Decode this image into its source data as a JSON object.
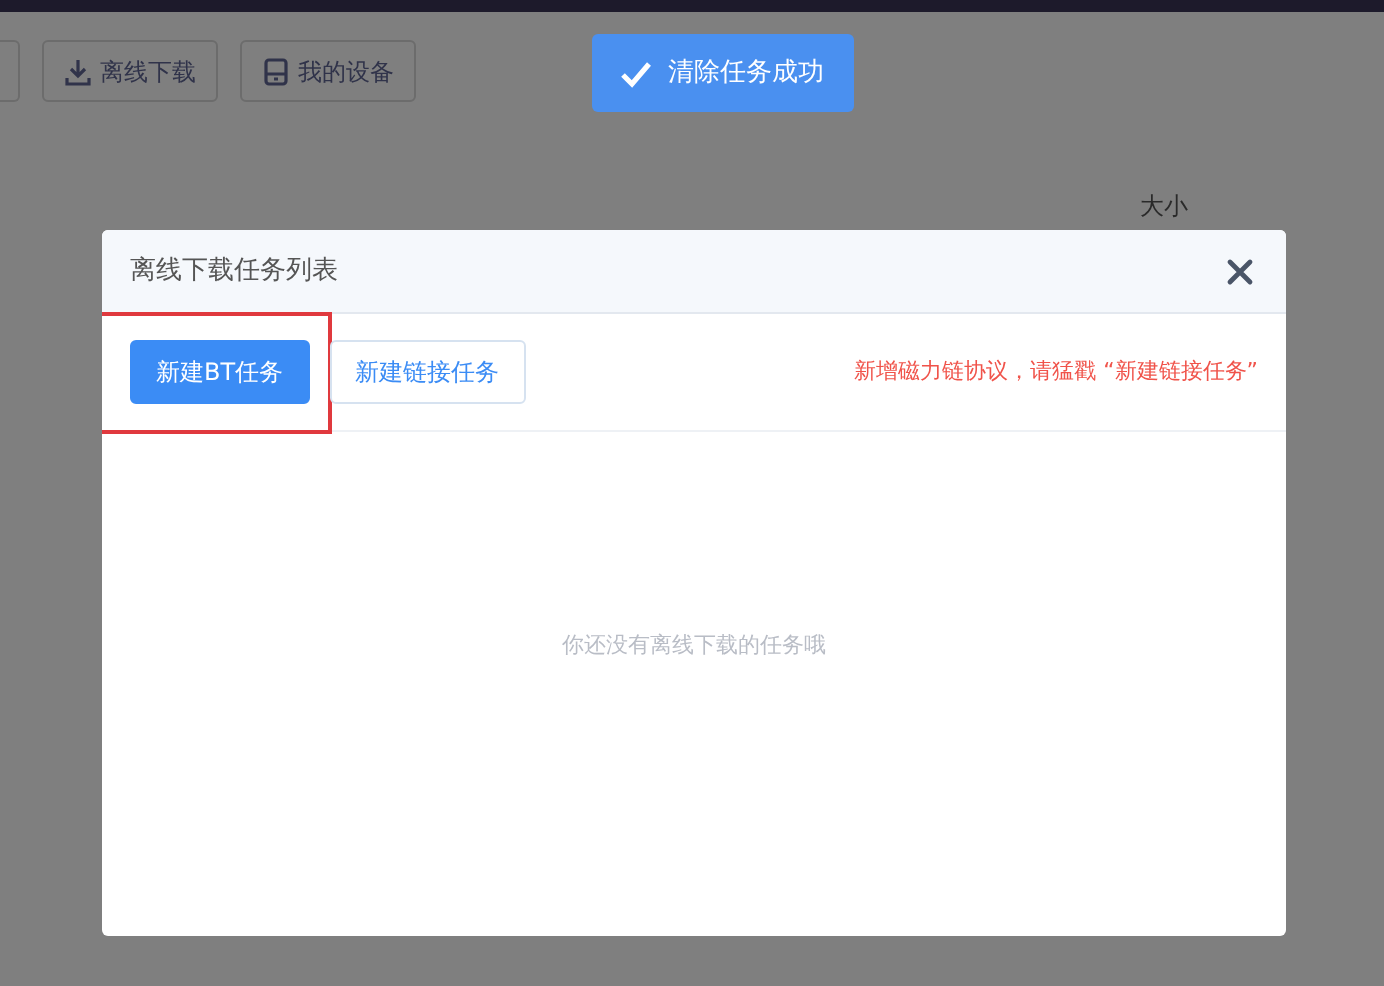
{
  "toolbar": {
    "buttons": [
      {
        "kind": "partial"
      },
      {
        "kind": "download",
        "label": "离线下载"
      },
      {
        "kind": "device",
        "label": "我的设备"
      }
    ]
  },
  "toast": {
    "message": "清除任务成功"
  },
  "background_table": {
    "column_header": "大小"
  },
  "dialog": {
    "title": "离线下载任务列表",
    "actions": [
      {
        "label": "新建BT任务",
        "kind": "primary",
        "highlighted": true
      },
      {
        "label": "新建链接任务",
        "kind": "outline",
        "highlighted": false
      }
    ],
    "notice": "新增磁力链协议，请猛戳 “新建链接任务”",
    "empty_text": "你还没有离线下载的任务哦"
  }
}
